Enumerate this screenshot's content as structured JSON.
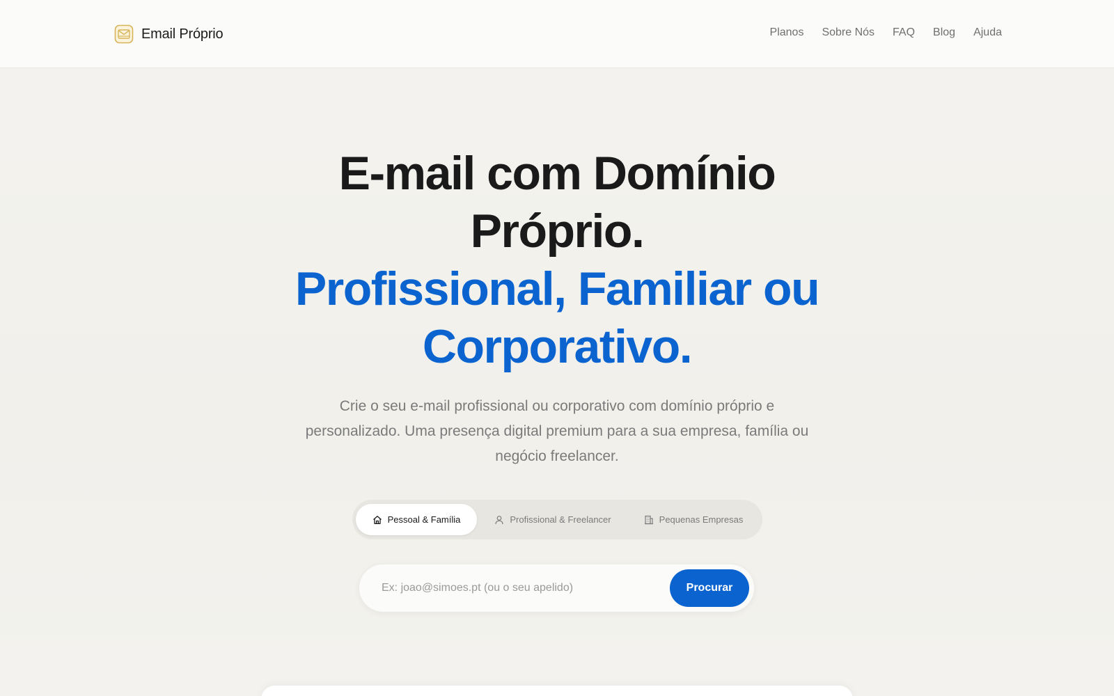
{
  "header": {
    "brand": "Email Próprio",
    "logo_icon": "envelope-icon",
    "nav": [
      "Planos",
      "Sobre Nós",
      "FAQ",
      "Blog",
      "Ajuda"
    ]
  },
  "hero": {
    "title_line1": "E-mail com Domínio",
    "title_line2": "Próprio.",
    "title_line3": "Profissional, Familiar ou",
    "title_line4": "Corporativo.",
    "subtitle": "Crie o seu e-mail profissional ou corporativo com domínio próprio e personalizado. Uma presença digital premium para a sua empresa, família ou negócio freelancer."
  },
  "segments": [
    {
      "label": "Pessoal & Família",
      "icon": "home-icon",
      "active": true
    },
    {
      "label": "Profissional & Freelancer",
      "icon": "user-icon",
      "active": false
    },
    {
      "label": "Pequenas Empresas",
      "icon": "building-icon",
      "active": false
    }
  ],
  "search": {
    "placeholder": "Ex: joao@simoes.pt (ou o seu apelido)",
    "button": "Procurar"
  },
  "colors": {
    "accent": "#0a63cf",
    "title": "#1a1a1a",
    "background": "#f3f2ee",
    "logo": "#d7b45a"
  }
}
